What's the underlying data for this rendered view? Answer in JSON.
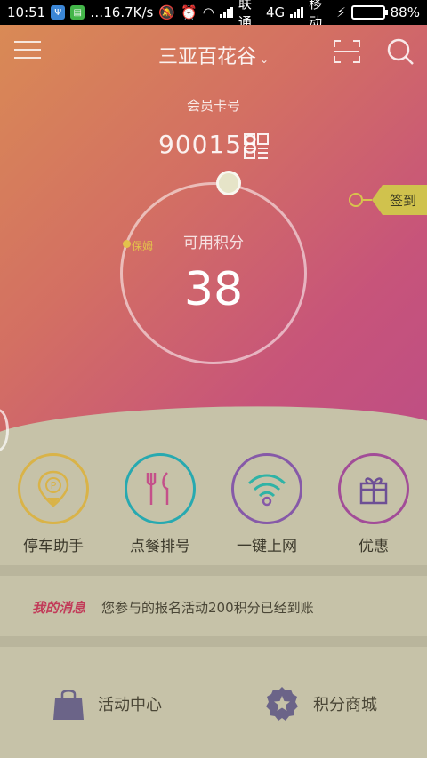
{
  "status": {
    "time": "10:51",
    "speed": "16.7K/s",
    "carrier1": "联通",
    "network": "4G",
    "carrier2": "移动",
    "battery": "88%",
    "battery_level": 0.88
  },
  "header": {
    "title": "三亚百花谷",
    "chevron": "⌄",
    "menu_icon": "hamburger-icon",
    "scan_icon": "scan-icon",
    "search_icon": "search-icon"
  },
  "member": {
    "card_label": "会员卡号",
    "card_number": "900158",
    "available_label": "可用积分",
    "points": "38",
    "baby_label": "保姆",
    "checkin_label": "签到"
  },
  "actions": [
    {
      "label": "停车助手",
      "icon": "parking-icon",
      "color": "#d9b348"
    },
    {
      "label": "点餐排号",
      "icon": "cutlery-icon",
      "color": "#c4508a"
    },
    {
      "label": "一键上网",
      "icon": "wifi-icon",
      "color": "#8659a8"
    },
    {
      "label": "优惠",
      "icon": "gift-icon",
      "color": "#6d4f95"
    }
  ],
  "message": {
    "tag": "我的消息",
    "text": "您参与的报名活动200积分已经到账"
  },
  "bottom": [
    {
      "label": "活动中心",
      "icon": "bag-icon"
    },
    {
      "label": "积分商城",
      "icon": "badge-icon"
    }
  ],
  "colors": {
    "gradient_start": "#d98a55",
    "gradient_end": "#be4e84",
    "background": "#c6c2a8",
    "accent_gold": "#d0c24d",
    "message_tag": "#c23b59"
  }
}
